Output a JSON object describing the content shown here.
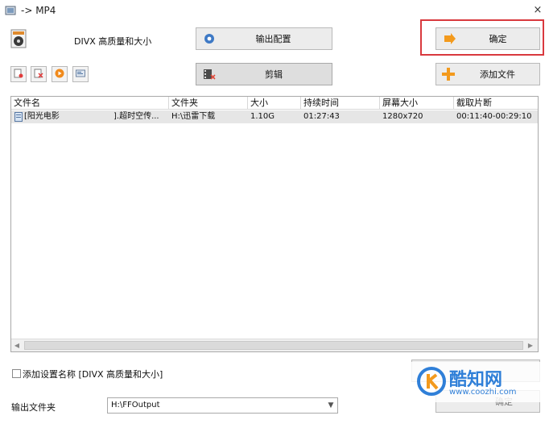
{
  "window": {
    "title": "-> MP4",
    "close_glyph": "×"
  },
  "preset": {
    "name": "DIVX 高质量和大小"
  },
  "buttons": {
    "output_config": "输出配置",
    "confirm": "确定",
    "clip": "剪辑",
    "add_file": "添加文件"
  },
  "toolbar": {
    "icons": [
      "remove-item-icon",
      "clear-list-icon",
      "play-icon",
      "media-info-icon"
    ]
  },
  "table": {
    "columns": [
      "文件名",
      "文件夹",
      "大小",
      "持续时间",
      "屏幕大小",
      "截取片断"
    ],
    "rows": [
      {
        "name": "[阳光电影",
        "name_tail": "].超时空传...",
        "folder": "H:\\迅雷下载",
        "size": "1.10G",
        "duration": "01:27:43",
        "resolution": "1280x720",
        "clip": "00:11:40-00:29:10"
      }
    ]
  },
  "bottom": {
    "checkbox_label": "添加设置名称 [DIVX 高质量和大小]",
    "output_folder_label": "输出文件夹",
    "output_folder_value": "H:\\FFOutput",
    "partial_button_label": "确定"
  },
  "watermark": {
    "brand": "酷知网",
    "url": "www.coozhi.com"
  },
  "colors": {
    "highlight": "#d9393e",
    "accent_orange": "#f39a1d",
    "watermark_blue": "#2f7fd8"
  }
}
